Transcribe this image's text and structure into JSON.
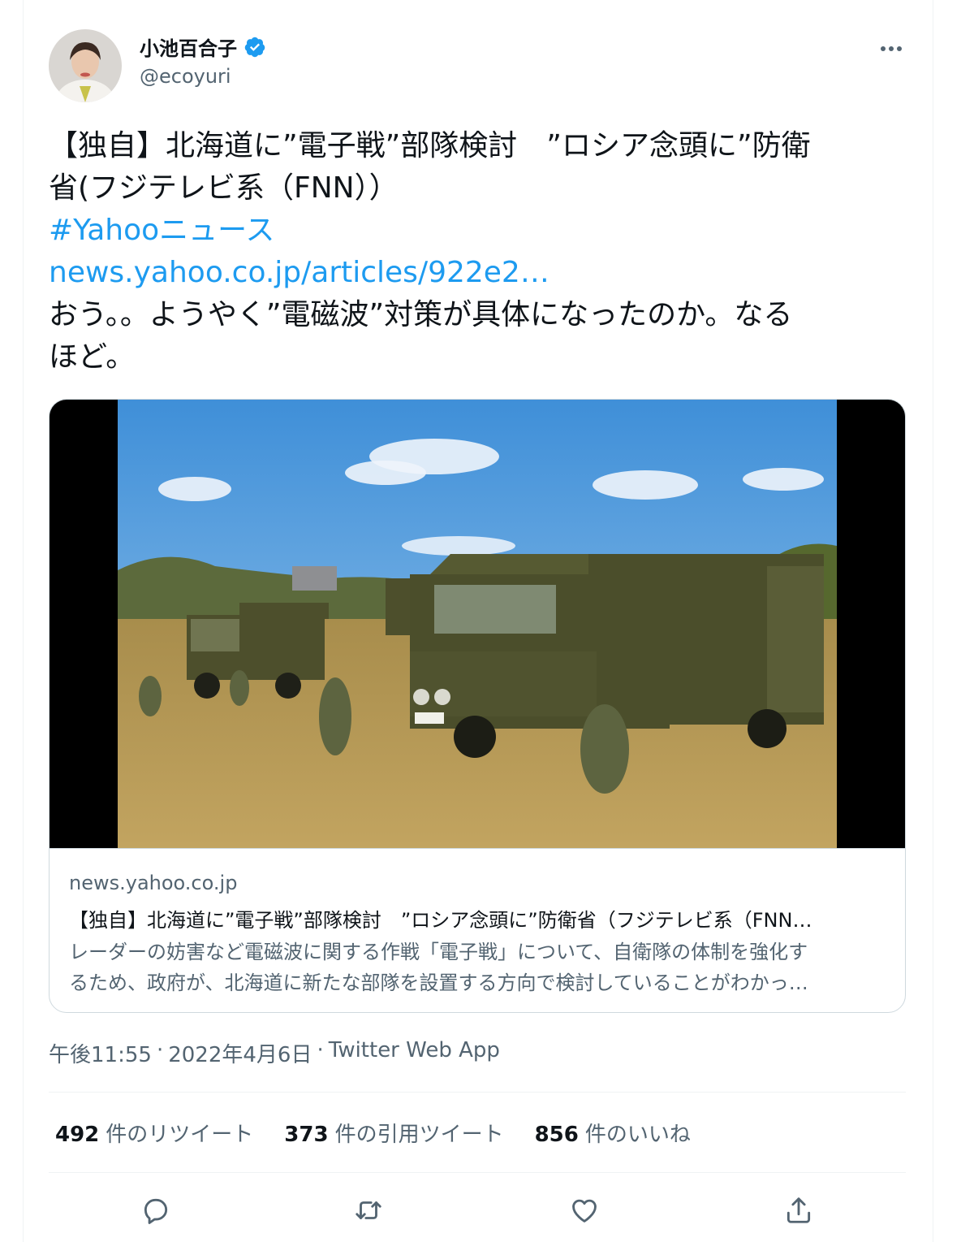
{
  "author": {
    "name": "小池百合子",
    "handle": "@ecoyuri",
    "verified": true
  },
  "tweet": {
    "text_line_1": "【独自】北海道に”電子戦”部隊検討　”ロシア念頭に”防衛",
    "text_line_2": "省(フジテレビ系（FNN））",
    "hashtag": "#Yahooニュース",
    "url": "news.yahoo.co.jp/articles/922e2…",
    "comment_line_1": "おう。。ようやく”電磁波”対策が具体になったのか。なる",
    "comment_line_2": "ほど。"
  },
  "link_card": {
    "image_icon": "military-trucks-photo",
    "domain": "news.yahoo.co.jp",
    "title": "【独自】北海道に”電子戦”部隊検討　”ロシア念頭に”防衛省（フジテレビ系（FNN…",
    "description_line_1": "レーダーの妨害など電磁波に関する作戦「電子戦」について、自衛隊の体制を強化す",
    "description_line_2": "るため、政府が、北海道に新たな部隊を設置する方向で検討していることがわかっ…"
  },
  "meta": {
    "time": "午後11:55",
    "separator": "·",
    "date": "2022年4月6日",
    "source": "Twitter Web App"
  },
  "stats": {
    "retweets_count": "492",
    "retweets_label": "件のリツイート",
    "quotes_count": "373",
    "quotes_label": "件の引用ツイート",
    "likes_count": "856",
    "likes_label": "件のいいね"
  },
  "colors": {
    "link": "#1d9bf0",
    "secondary_text": "#536471",
    "border": "#cfd9de"
  }
}
